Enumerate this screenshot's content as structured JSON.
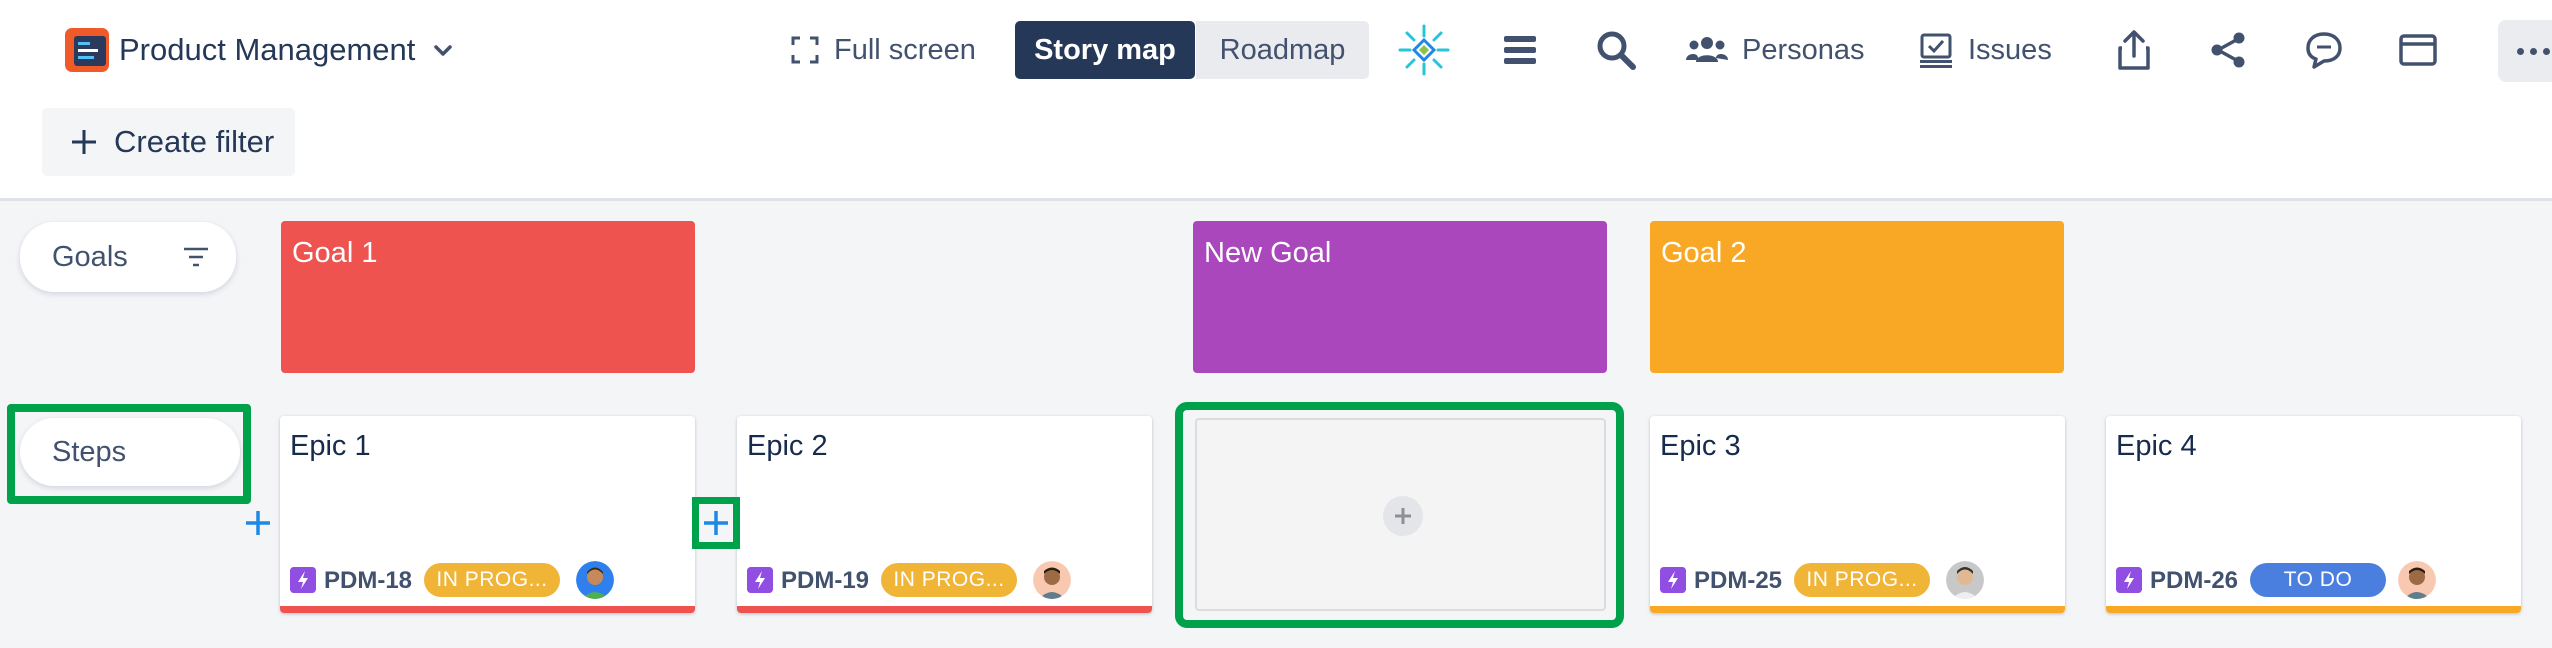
{
  "app": {
    "title": "Product Management"
  },
  "toolbar": {
    "fullscreen_label": "Full screen",
    "view_tabs": [
      {
        "label": "Story map",
        "active": true
      },
      {
        "label": "Roadmap",
        "active": false
      }
    ],
    "personas_label": "Personas",
    "issues_label": "Issues",
    "icons": [
      "structure-icon",
      "list-icon",
      "search-icon",
      "personas-icon",
      "issues-icon",
      "share-export-icon",
      "share-icon",
      "comment-icon",
      "window-icon",
      "more-icon"
    ]
  },
  "filter": {
    "create_label": "Create filter"
  },
  "rows": {
    "goals_label": "Goals",
    "steps_label": "Steps"
  },
  "goals": [
    {
      "title": "Goal 1",
      "color": "#ef5350"
    },
    {
      "title": "New Goal",
      "color": "#ab47bc"
    },
    {
      "title": "Goal 2",
      "color": "#f9a825"
    }
  ],
  "epics": [
    {
      "title": "Epic 1",
      "key": "PDM-18",
      "status": "IN PROG...",
      "status_color": "#f0b437",
      "bar_color": "#ef5350"
    },
    {
      "title": "Epic 2",
      "key": "PDM-19",
      "status": "IN PROG...",
      "status_color": "#f0b437",
      "bar_color": "#ef5350"
    },
    {
      "title": "Epic 3",
      "key": "PDM-25",
      "status": "IN PROG...",
      "status_color": "#f0b437",
      "bar_color": "#f9a825"
    },
    {
      "title": "Epic 4",
      "key": "PDM-26",
      "status": "TO DO",
      "status_color": "#4a7fe0",
      "bar_color": "#f9a825"
    }
  ],
  "colors": {
    "accent_dark": "#253858",
    "highlight": "#00a14b",
    "add_blue": "#1e88e5",
    "epic_purple": "#904ee2"
  }
}
